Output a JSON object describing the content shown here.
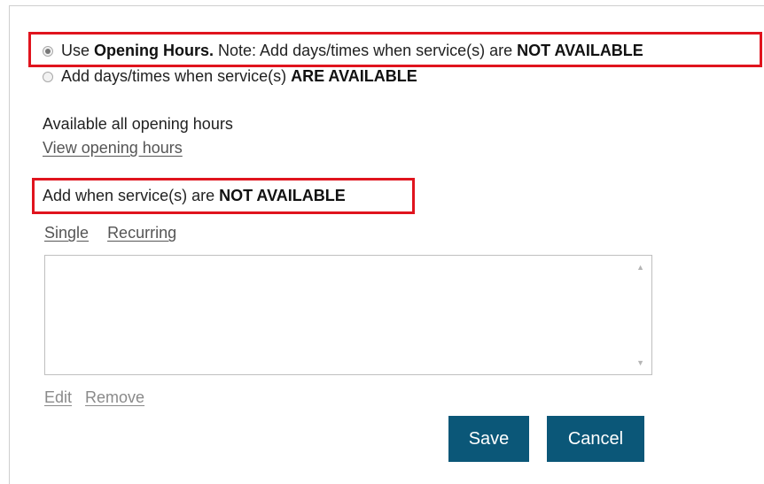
{
  "options": {
    "opening_hours": {
      "prefix": "Use ",
      "bold": "Opening Hours.",
      "middle": " Note: Add days/times when service(s) are ",
      "bold_end": "NOT AVAILABLE"
    },
    "custom": {
      "prefix": "Add days/times when service(s) ",
      "bold": "ARE AVAILABLE"
    }
  },
  "availability": {
    "status_text": "Available all opening hours",
    "view_link": "View opening hours"
  },
  "not_available": {
    "heading_prefix": "Add when service(s) are ",
    "heading_bold": "NOT AVAILABLE",
    "tabs": [
      "Single",
      "Recurring"
    ]
  },
  "list_actions": {
    "edit": "Edit",
    "remove": "Remove"
  },
  "buttons": {
    "save": "Save",
    "cancel": "Cancel"
  },
  "colors": {
    "highlight": "#e0141e",
    "button": "#0b5778"
  }
}
